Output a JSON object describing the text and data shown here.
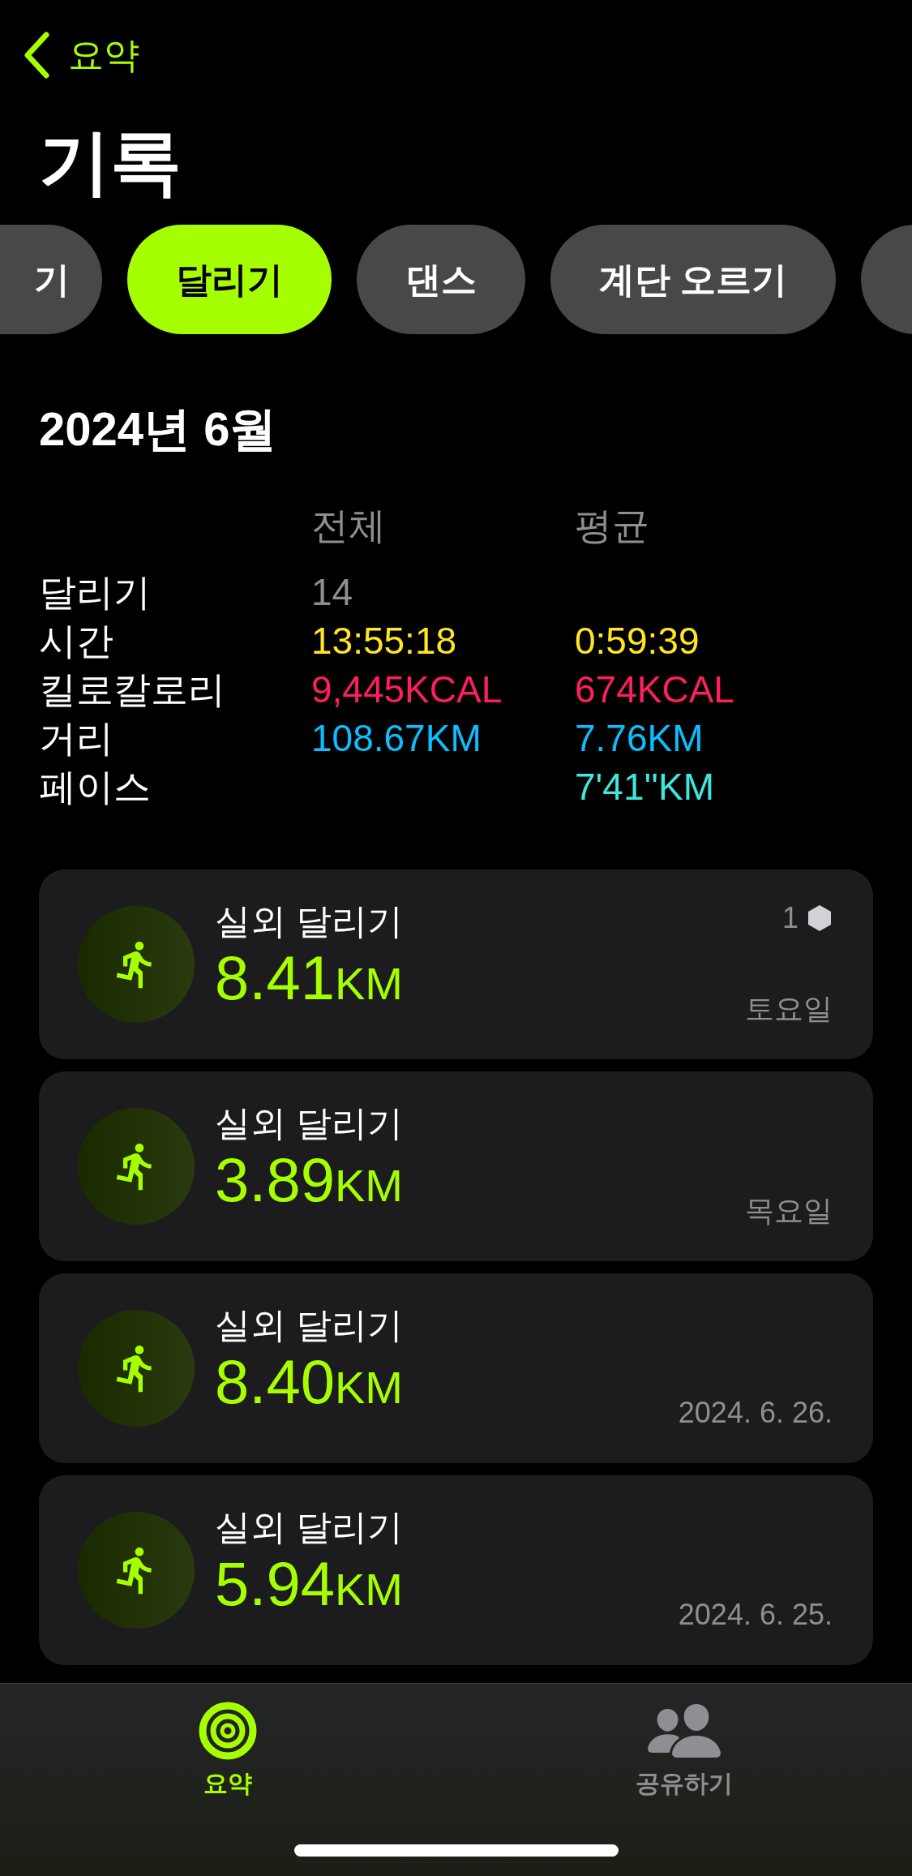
{
  "nav": {
    "back_label": "요약"
  },
  "title": "기록",
  "chips": [
    {
      "label": "기",
      "selected": false
    },
    {
      "label": "달리기",
      "selected": true
    },
    {
      "label": "댄스",
      "selected": false
    },
    {
      "label": "계단 오르기",
      "selected": false
    },
    {
      "selected": false
    }
  ],
  "month": "2024년 6월",
  "stats": {
    "columns": [
      "전체",
      "평균"
    ],
    "rows": [
      {
        "label": "달리기",
        "total": "14",
        "color": "#8e8e93"
      },
      {
        "label": "시간",
        "total": "13:55:18",
        "average": "0:59:39",
        "color": "#ffe620"
      },
      {
        "label": "킬로칼로리",
        "total": "9,445KCAL",
        "average": "674KCAL",
        "color": "#ff1f5a"
      },
      {
        "label": "거리",
        "total": "108.67KM",
        "average": "7.76KM",
        "color": "#0abfff"
      },
      {
        "label": "페이스",
        "average": "7'41''KM",
        "color": "#3ee8e0"
      }
    ]
  },
  "workouts": [
    {
      "title": "실외 달리기",
      "distance": "8.41",
      "unit": "KM",
      "badge": "1",
      "date": "토요일"
    },
    {
      "title": "실외 달리기",
      "distance": "3.89",
      "unit": "KM",
      "date": "목요일"
    },
    {
      "title": "실외 달리기",
      "distance": "8.40",
      "unit": "KM",
      "date": "2024. 6. 26."
    },
    {
      "title": "실외 달리기",
      "distance": "5.94",
      "unit": "KM",
      "date": "2024. 6. 25."
    }
  ],
  "tab_bar": [
    {
      "label": "요약",
      "kind": "summary",
      "selected": true
    },
    {
      "label": "공유하기",
      "kind": "sharing",
      "selected": false
    }
  ]
}
